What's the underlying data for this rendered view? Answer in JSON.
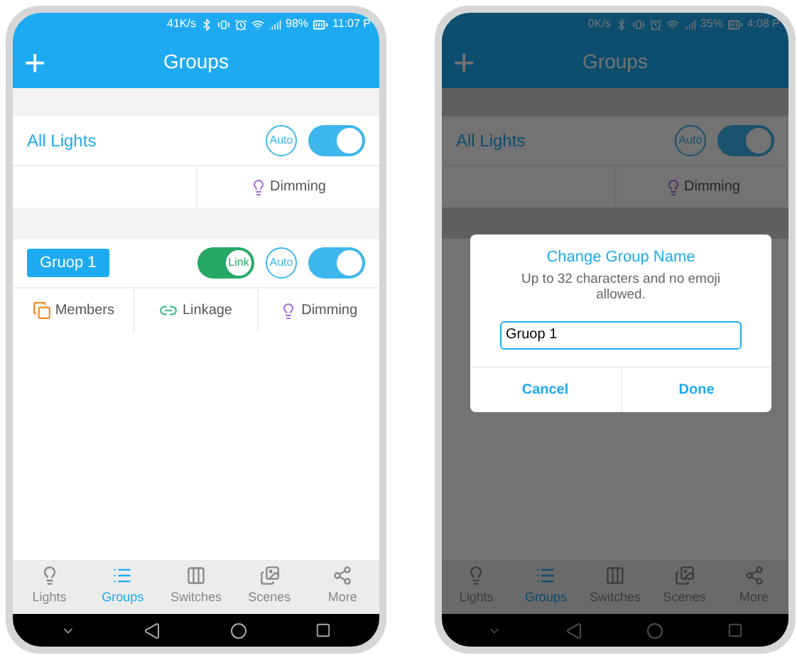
{
  "phones": [
    {
      "status": {
        "speed": "41K/s",
        "battery": "98%",
        "time": "11:07 P"
      },
      "header": {
        "add": "+",
        "title": "Groups"
      },
      "all_lights": {
        "name": "All Lights",
        "auto": "Auto",
        "on": true,
        "dimming": "Dimming"
      },
      "groups": [
        {
          "name": "Gruop 1",
          "link": "Link",
          "link_on": true,
          "auto": "Auto",
          "on": true,
          "actions": [
            {
              "kind": "members",
              "label": "Members"
            },
            {
              "kind": "linkage",
              "label": "Linkage"
            },
            {
              "kind": "dimming",
              "label": "Dimming"
            }
          ]
        }
      ],
      "tabs": [
        {
          "kind": "lights",
          "label": "Lights",
          "selected": false
        },
        {
          "kind": "groups",
          "label": "Groups",
          "selected": true
        },
        {
          "kind": "switches",
          "label": "Switches",
          "selected": false
        },
        {
          "kind": "scenes",
          "label": "Scenes",
          "selected": false
        },
        {
          "kind": "more",
          "label": "More",
          "selected": false
        }
      ]
    },
    {
      "status": {
        "speed": "0K/s",
        "battery": "35%",
        "time": "4:08 P"
      },
      "header": {
        "add": "+",
        "title": "Groups"
      },
      "all_lights": {
        "name": "All Lights",
        "auto": "Auto",
        "on": true,
        "dimming": "Dimming"
      },
      "tabs": [
        {
          "kind": "lights",
          "label": "Lights",
          "selected": false
        },
        {
          "kind": "groups",
          "label": "Groups",
          "selected": true
        },
        {
          "kind": "switches",
          "label": "Switches",
          "selected": false
        },
        {
          "kind": "scenes",
          "label": "Scenes",
          "selected": false
        },
        {
          "kind": "more",
          "label": "More",
          "selected": false
        }
      ],
      "dialog": {
        "title": "Change Group Name",
        "message": "Up to 32 characters and no emoji allowed.",
        "value": "Gruop 1",
        "buttons": [
          "Cancel",
          "Done"
        ]
      }
    }
  ]
}
